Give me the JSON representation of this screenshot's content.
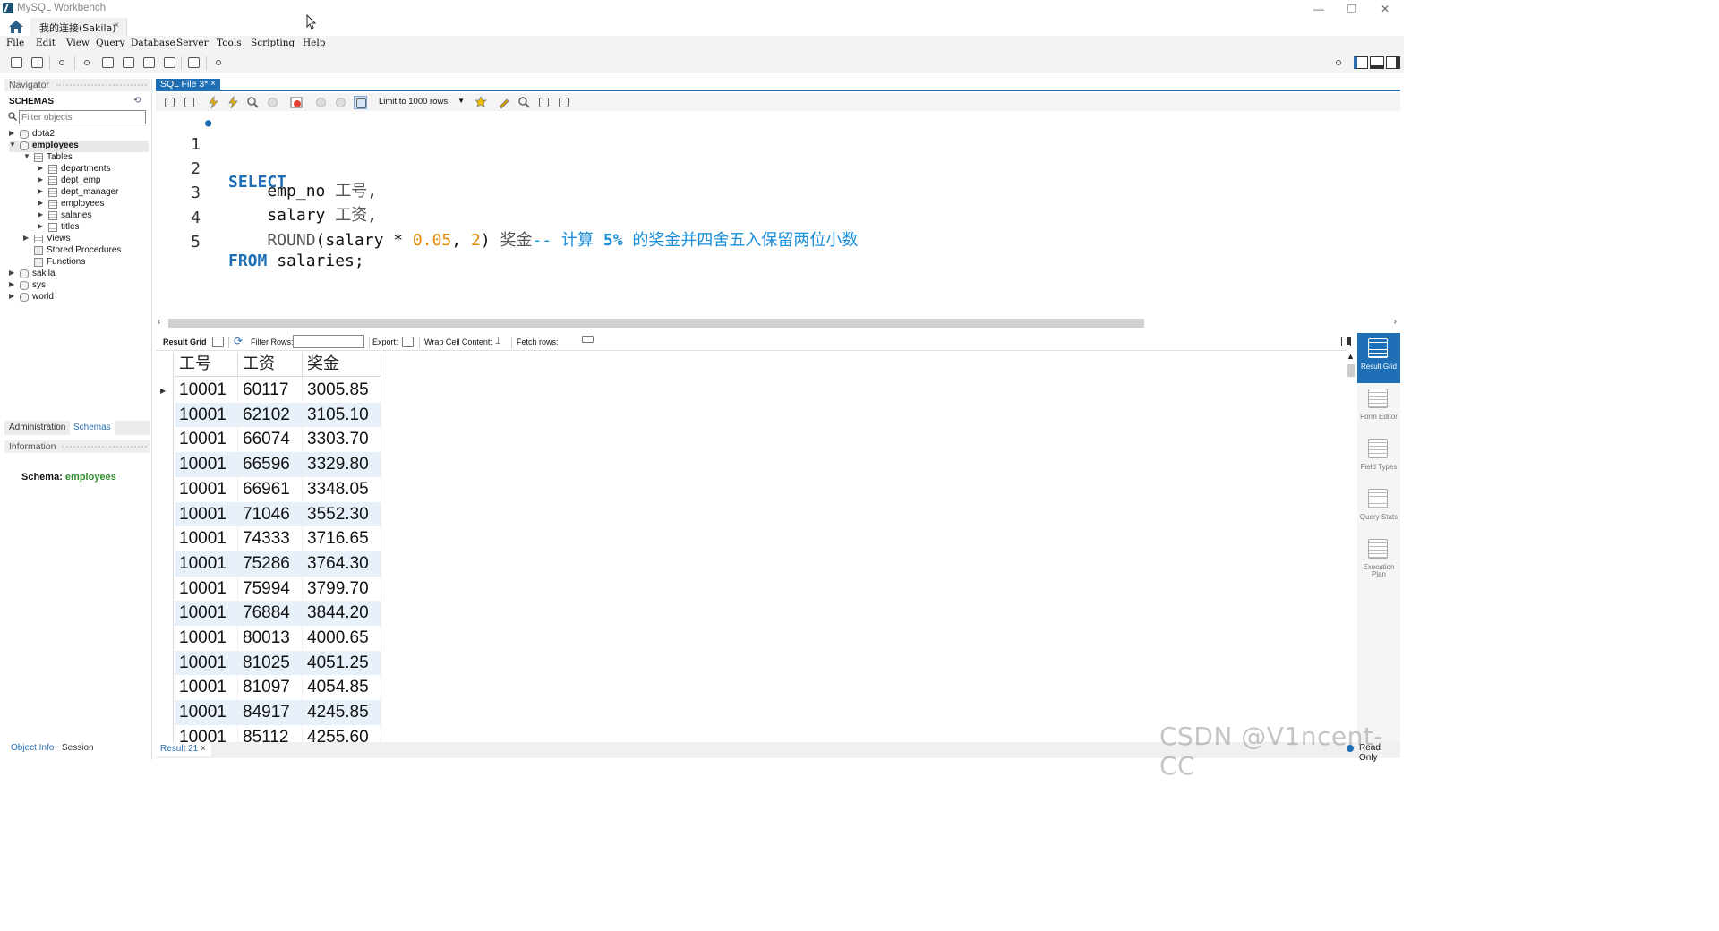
{
  "window": {
    "title": "MySQL Workbench",
    "minimize": "—",
    "restore": "❐",
    "close": "✕"
  },
  "connection_tab": {
    "label": "我的连接(Sakila)",
    "close": "×"
  },
  "menu": [
    "File",
    "Edit",
    "View",
    "Query",
    "Database",
    "Server",
    "Tools",
    "Scripting",
    "Help"
  ],
  "navigator": {
    "header": "Navigator",
    "schemas_title": "SCHEMAS",
    "filter_placeholder": "Filter objects",
    "tree": [
      {
        "label": "dota2",
        "expanded": false
      },
      {
        "label": "employees",
        "expanded": true,
        "bold": true
      },
      {
        "label": "Tables",
        "expanded": true
      },
      {
        "label": "departments"
      },
      {
        "label": "dept_emp"
      },
      {
        "label": "dept_manager"
      },
      {
        "label": "employees"
      },
      {
        "label": "salaries"
      },
      {
        "label": "titles"
      },
      {
        "label": "Views"
      },
      {
        "label": "Stored Procedures"
      },
      {
        "label": "Functions"
      },
      {
        "label": "sakila"
      },
      {
        "label": "sys"
      },
      {
        "label": "world"
      }
    ],
    "tabs": {
      "administration": "Administration",
      "schemas": "Schemas"
    },
    "info_header": "Information",
    "schema_label": "Schema:",
    "schema_value": "employees",
    "bottom_tabs": {
      "object_info": "Object Info",
      "session": "Session"
    }
  },
  "sql_tab": {
    "label": "SQL File 3*",
    "close": "×"
  },
  "sql_toolbar": {
    "limit": "Limit to 1000 rows"
  },
  "editor": {
    "lines": [
      {
        "n": "1",
        "text": "SELECT"
      },
      {
        "n": "2",
        "text": "    emp_no 工号,"
      },
      {
        "n": "3",
        "text": "    salary 工资,"
      },
      {
        "n": "4",
        "text": "    ROUND(salary * 0.05, 2) 奖金-- 计算 5% 的奖金并四舍五入保留两位小数"
      },
      {
        "n": "5",
        "text": "FROM salaries;"
      }
    ]
  },
  "result_toolbar": {
    "result_grid": "Result Grid",
    "filter_rows": "Filter Rows:",
    "export": "Export:",
    "wrap": "Wrap Cell Content:",
    "fetch": "Fetch rows:"
  },
  "grid": {
    "columns": [
      "工号",
      "工资",
      "奖金"
    ],
    "rows": [
      [
        "10001",
        "60117",
        "3005.85"
      ],
      [
        "10001",
        "62102",
        "3105.10"
      ],
      [
        "10001",
        "66074",
        "3303.70"
      ],
      [
        "10001",
        "66596",
        "3329.80"
      ],
      [
        "10001",
        "66961",
        "3348.05"
      ],
      [
        "10001",
        "71046",
        "3552.30"
      ],
      [
        "10001",
        "74333",
        "3716.65"
      ],
      [
        "10001",
        "75286",
        "3764.30"
      ],
      [
        "10001",
        "75994",
        "3799.70"
      ],
      [
        "10001",
        "76884",
        "3844.20"
      ],
      [
        "10001",
        "80013",
        "4000.65"
      ],
      [
        "10001",
        "81025",
        "4051.25"
      ],
      [
        "10001",
        "81097",
        "4054.85"
      ],
      [
        "10001",
        "84917",
        "4245.85"
      ],
      [
        "10001",
        "85112",
        "4255.60"
      ]
    ]
  },
  "side_panel": [
    {
      "label": "Result Grid",
      "active": true
    },
    {
      "label": "Form Editor"
    },
    {
      "label": "Field Types"
    },
    {
      "label": "Query Stats"
    },
    {
      "label": "Execution Plan"
    }
  ],
  "bottom": {
    "result_tab": "Result 21",
    "close": "×",
    "status": "Read Only"
  },
  "watermark": "CSDN @V1ncent-CC"
}
